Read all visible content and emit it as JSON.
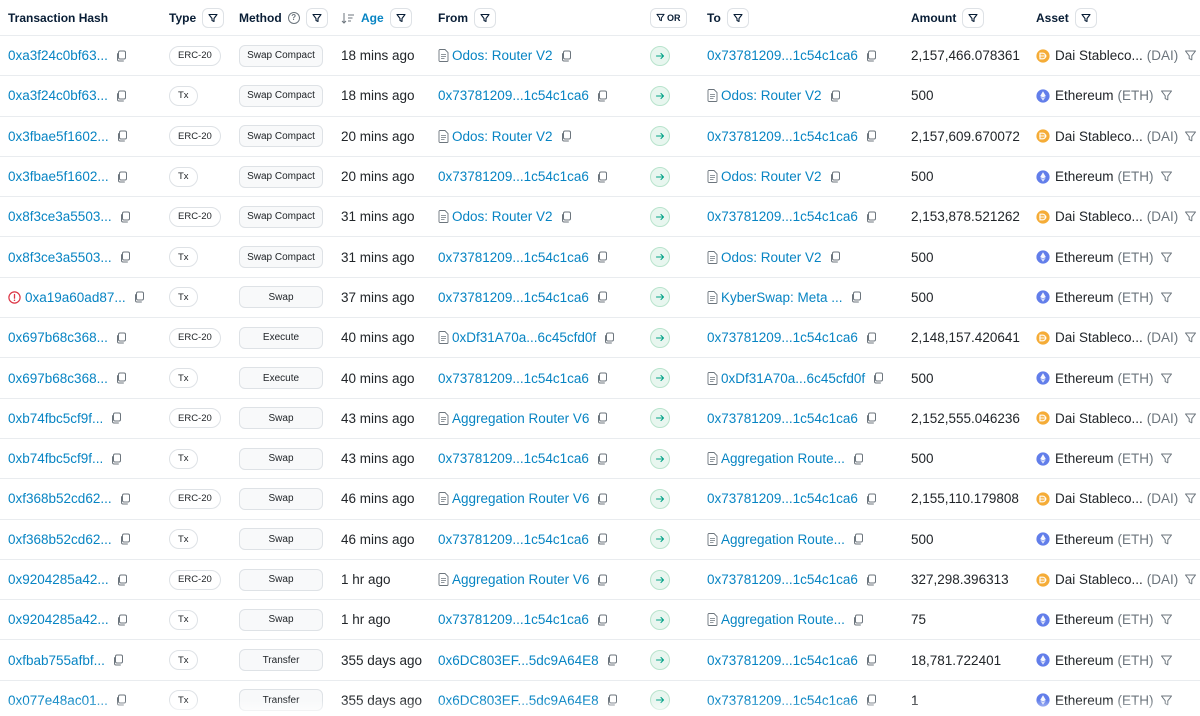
{
  "columns": {
    "hash": "Transaction Hash",
    "type": "Type",
    "method": "Method",
    "age": "Age",
    "from": "From",
    "or": "OR",
    "to": "To",
    "amount": "Amount",
    "asset": "Asset"
  },
  "colors": {
    "link": "#0784c3",
    "dai": "#f5ac37",
    "eth": "#627eea",
    "error": "#dc3545",
    "arrow": "#00a186"
  },
  "rows": [
    {
      "hash": "0xa3f24c0bf63...",
      "error": false,
      "type": "ERC-20",
      "method": "Swap Compact",
      "age": "18 mins ago",
      "from": "Odos: Router V2",
      "from_contract": true,
      "to": "0x73781209...1c54c1ca6",
      "to_contract": false,
      "amount": "2,157,466.078361",
      "asset": "Dai Stableco...",
      "symbol": "(DAI)",
      "token": "dai"
    },
    {
      "hash": "0xa3f24c0bf63...",
      "error": false,
      "type": "Tx",
      "method": "Swap Compact",
      "age": "18 mins ago",
      "from": "0x73781209...1c54c1ca6",
      "from_contract": false,
      "to": "Odos: Router V2",
      "to_contract": true,
      "amount": "500",
      "asset": "Ethereum",
      "symbol": "(ETH)",
      "token": "eth"
    },
    {
      "hash": "0x3fbae5f1602...",
      "error": false,
      "type": "ERC-20",
      "method": "Swap Compact",
      "age": "20 mins ago",
      "from": "Odos: Router V2",
      "from_contract": true,
      "to": "0x73781209...1c54c1ca6",
      "to_contract": false,
      "amount": "2,157,609.670072",
      "asset": "Dai Stableco...",
      "symbol": "(DAI)",
      "token": "dai"
    },
    {
      "hash": "0x3fbae5f1602...",
      "error": false,
      "type": "Tx",
      "method": "Swap Compact",
      "age": "20 mins ago",
      "from": "0x73781209...1c54c1ca6",
      "from_contract": false,
      "to": "Odos: Router V2",
      "to_contract": true,
      "amount": "500",
      "asset": "Ethereum",
      "symbol": "(ETH)",
      "token": "eth"
    },
    {
      "hash": "0x8f3ce3a5503...",
      "error": false,
      "type": "ERC-20",
      "method": "Swap Compact",
      "age": "31 mins ago",
      "from": "Odos: Router V2",
      "from_contract": true,
      "to": "0x73781209...1c54c1ca6",
      "to_contract": false,
      "amount": "2,153,878.521262",
      "asset": "Dai Stableco...",
      "symbol": "(DAI)",
      "token": "dai"
    },
    {
      "hash": "0x8f3ce3a5503...",
      "error": false,
      "type": "Tx",
      "method": "Swap Compact",
      "age": "31 mins ago",
      "from": "0x73781209...1c54c1ca6",
      "from_contract": false,
      "to": "Odos: Router V2",
      "to_contract": true,
      "amount": "500",
      "asset": "Ethereum",
      "symbol": "(ETH)",
      "token": "eth"
    },
    {
      "hash": "0xa19a60ad87...",
      "error": true,
      "type": "Tx",
      "method": "Swap",
      "age": "37 mins ago",
      "from": "0x73781209...1c54c1ca6",
      "from_contract": false,
      "to": "KyberSwap: Meta ...",
      "to_contract": true,
      "amount": "500",
      "asset": "Ethereum",
      "symbol": "(ETH)",
      "token": "eth"
    },
    {
      "hash": "0x697b68c368...",
      "error": false,
      "type": "ERC-20",
      "method": "Execute",
      "age": "40 mins ago",
      "from": "0xDf31A70a...6c45cfd0f",
      "from_contract": true,
      "to": "0x73781209...1c54c1ca6",
      "to_contract": false,
      "amount": "2,148,157.420641",
      "asset": "Dai Stableco...",
      "symbol": "(DAI)",
      "token": "dai"
    },
    {
      "hash": "0x697b68c368...",
      "error": false,
      "type": "Tx",
      "method": "Execute",
      "age": "40 mins ago",
      "from": "0x73781209...1c54c1ca6",
      "from_contract": false,
      "to": "0xDf31A70a...6c45cfd0f",
      "to_contract": true,
      "amount": "500",
      "asset": "Ethereum",
      "symbol": "(ETH)",
      "token": "eth"
    },
    {
      "hash": "0xb74fbc5cf9f...",
      "error": false,
      "type": "ERC-20",
      "method": "Swap",
      "age": "43 mins ago",
      "from": "Aggregation Router V6",
      "from_contract": true,
      "to": "0x73781209...1c54c1ca6",
      "to_contract": false,
      "amount": "2,152,555.046236",
      "asset": "Dai Stableco...",
      "symbol": "(DAI)",
      "token": "dai"
    },
    {
      "hash": "0xb74fbc5cf9f...",
      "error": false,
      "type": "Tx",
      "method": "Swap",
      "age": "43 mins ago",
      "from": "0x73781209...1c54c1ca6",
      "from_contract": false,
      "to": "Aggregation Route...",
      "to_contract": true,
      "amount": "500",
      "asset": "Ethereum",
      "symbol": "(ETH)",
      "token": "eth"
    },
    {
      "hash": "0xf368b52cd62...",
      "error": false,
      "type": "ERC-20",
      "method": "Swap",
      "age": "46 mins ago",
      "from": "Aggregation Router V6",
      "from_contract": true,
      "to": "0x73781209...1c54c1ca6",
      "to_contract": false,
      "amount": "2,155,110.179808",
      "asset": "Dai Stableco...",
      "symbol": "(DAI)",
      "token": "dai"
    },
    {
      "hash": "0xf368b52cd62...",
      "error": false,
      "type": "Tx",
      "method": "Swap",
      "age": "46 mins ago",
      "from": "0x73781209...1c54c1ca6",
      "from_contract": false,
      "to": "Aggregation Route...",
      "to_contract": true,
      "amount": "500",
      "asset": "Ethereum",
      "symbol": "(ETH)",
      "token": "eth"
    },
    {
      "hash": "0x9204285a42...",
      "error": false,
      "type": "ERC-20",
      "method": "Swap",
      "age": "1 hr ago",
      "from": "Aggregation Router V6",
      "from_contract": true,
      "to": "0x73781209...1c54c1ca6",
      "to_contract": false,
      "amount": "327,298.396313",
      "asset": "Dai Stableco...",
      "symbol": "(DAI)",
      "token": "dai"
    },
    {
      "hash": "0x9204285a42...",
      "error": false,
      "type": "Tx",
      "method": "Swap",
      "age": "1 hr ago",
      "from": "0x73781209...1c54c1ca6",
      "from_contract": false,
      "to": "Aggregation Route...",
      "to_contract": true,
      "amount": "75",
      "asset": "Ethereum",
      "symbol": "(ETH)",
      "token": "eth"
    },
    {
      "hash": "0xfbab755afbf...",
      "error": false,
      "type": "Tx",
      "method": "Transfer",
      "age": "355 days ago",
      "from": "0x6DC803EF...5dc9A64E8",
      "from_contract": false,
      "to": "0x73781209...1c54c1ca6",
      "to_contract": false,
      "amount": "18,781.722401",
      "asset": "Ethereum",
      "symbol": "(ETH)",
      "token": "eth"
    },
    {
      "hash": "0x077e48ac01...",
      "error": false,
      "type": "Tx",
      "method": "Transfer",
      "age": "355 days ago",
      "from": "0x6DC803EF...5dc9A64E8",
      "from_contract": false,
      "to": "0x73781209...1c54c1ca6",
      "to_contract": false,
      "amount": "1",
      "asset": "Ethereum",
      "symbol": "(ETH)",
      "token": "eth"
    }
  ]
}
